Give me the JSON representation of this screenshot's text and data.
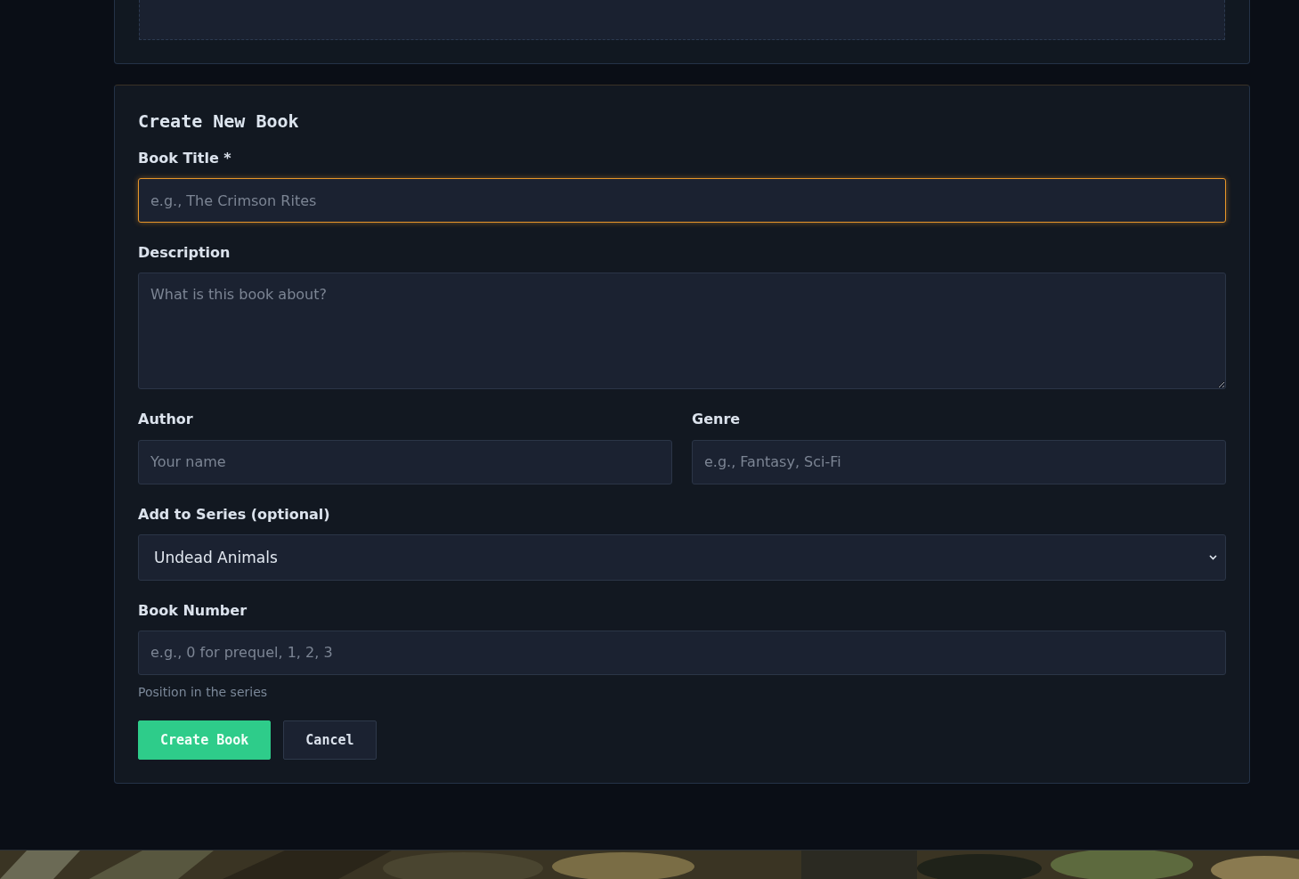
{
  "form": {
    "title": "Create New Book",
    "fields": [
      {
        "kind": "input",
        "label": "Book Title *",
        "placeholder": "e.g., The Crimson Rites",
        "focused": true
      },
      {
        "kind": "textarea",
        "label": "Description",
        "placeholder": "What is this book about?",
        "focused": false
      }
    ],
    "pair": [
      {
        "kind": "input",
        "label": "Author",
        "placeholder": "Your name",
        "focused": false
      },
      {
        "kind": "input",
        "label": "Genre",
        "placeholder": "e.g., Fantasy, Sci-Fi",
        "focused": false
      }
    ],
    "series": {
      "label": "Add to Series (optional)",
      "value": "Undead Animals"
    },
    "number": {
      "label": "Book Number",
      "placeholder": "e.g., 0 for prequel, 1, 2, 3",
      "hint": "Position in the series",
      "focused": false
    },
    "buttons": [
      {
        "label": "Create Book",
        "kind": "primary"
      },
      {
        "label": "Cancel",
        "kind": "secondary"
      }
    ]
  }
}
